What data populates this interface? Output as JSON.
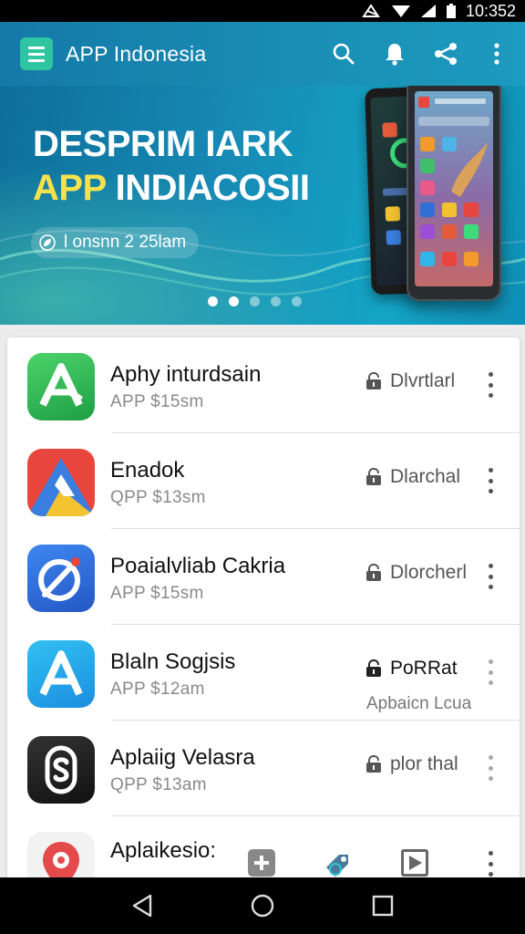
{
  "status_bar": {
    "time": "10:352",
    "icons": [
      "signal-icon",
      "wifi-icon",
      "cellular-icon",
      "battery-icon"
    ]
  },
  "app_bar": {
    "title": "APP Indonesia",
    "actions": [
      "search-icon",
      "bell-icon",
      "share-icon",
      "more-vert-icon"
    ],
    "accent_color": "#2ec5a0",
    "bar_color": "#1a8fb5"
  },
  "banner": {
    "title_line1": "DESPRIM IARK",
    "title_line2_accent": "APP",
    "title_line2_rest": " INDIACOSII",
    "chip_text": "l onsnn 2 25lam",
    "slides_count": 5,
    "active_slides": [
      0,
      1
    ]
  },
  "app_list": [
    {
      "name": "Aphy inturdsain",
      "subtitle": "APP $15sm",
      "action_label": "Dlvrtlarl",
      "icon": "green-a-icon",
      "icon_color": "#2fb552"
    },
    {
      "name": "Enadok",
      "subtitle": "QPP $13sm",
      "action_label": "Dlarchal",
      "icon": "tricolor-a-icon",
      "icon_color": "#e8453c"
    },
    {
      "name": "Poaialvliab Cakria",
      "subtitle": "APP $15sm",
      "action_label": "Dlorcherl",
      "icon": "compass-icon",
      "icon_color": "#2f6fd6"
    },
    {
      "name": "Blaln Sogjsis",
      "subtitle": "APP $12am",
      "action_label": "PoRRat",
      "action_sub": "Apbaicn Lcua",
      "icon": "blue-a-icon",
      "icon_color": "#1ea6e8"
    },
    {
      "name": "Aplaiig Velasra",
      "subtitle": "QPP $13am",
      "action_label": "plor thal",
      "icon": "shield-s-icon",
      "icon_color": "#1d1d1d"
    },
    {
      "name": "Aplaikesio:",
      "icon": "pin-icon",
      "icon_color": "#e44a4a",
      "actions": [
        "add-icon",
        "tag-icon",
        "play-icon",
        "more-vert-icon"
      ]
    }
  ],
  "nav_bar": {
    "buttons": [
      "back-icon",
      "home-icon",
      "recents-icon"
    ]
  }
}
